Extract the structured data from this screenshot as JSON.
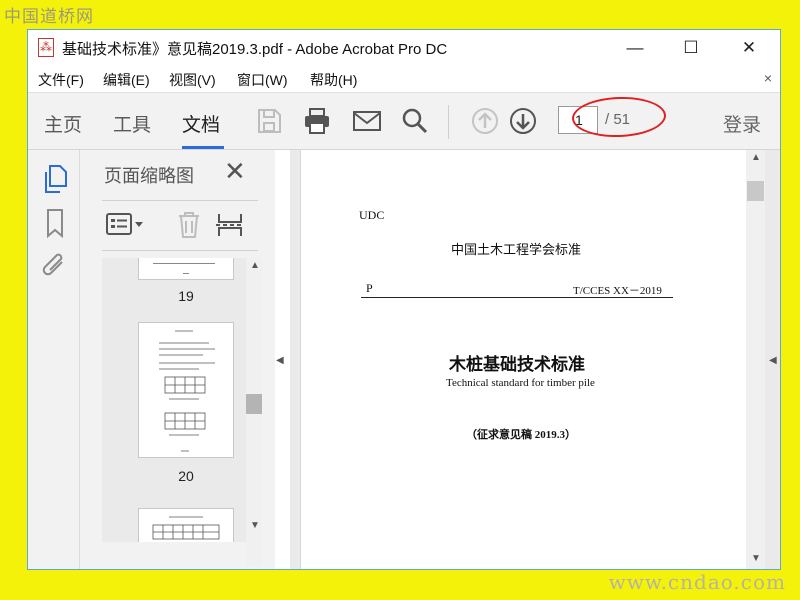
{
  "watermarks": {
    "top": "中国道桥网",
    "bottom": "www.cndao.com"
  },
  "window": {
    "title": "基础技术标准》意见稿2019.3.pdf - Adobe Acrobat Pro DC",
    "controls": {
      "minimize": "—",
      "maximize": "☐",
      "close": "✕"
    }
  },
  "menubar": {
    "items": [
      "文件(F)",
      "编辑(E)",
      "视图(V)",
      "窗口(W)",
      "帮助(H)"
    ],
    "close_doc": "×"
  },
  "toolbar": {
    "tabs": [
      "主页",
      "工具",
      "文档"
    ],
    "active_tab": "文档",
    "page_current": "1",
    "page_total": "/ 51",
    "login": "登录",
    "icons": [
      "save-icon",
      "print-icon",
      "email-icon",
      "search-icon",
      "page-up-icon",
      "page-down-icon"
    ]
  },
  "left_strip": {
    "icons": [
      "page-thumbnails-icon",
      "bookmark-icon",
      "attachment-icon"
    ]
  },
  "panel": {
    "title": "页面缩略图",
    "close": "✕",
    "thumbnails": [
      {
        "label": "19"
      },
      {
        "label": "20"
      },
      {
        "label": ""
      }
    ]
  },
  "document": {
    "udc": "UDC",
    "org_standard": "中国土木工程学会标准",
    "p": "P",
    "code": "T/CCES XX－2019",
    "title_cn": "木桩基础技术标准",
    "title_en": "Technical standard for timber pile",
    "draft": "（征求意见稿 2019.3）"
  },
  "colors": {
    "accent": "#2b6cd9",
    "highlight": "#e02020",
    "window_border": "#5aa8e0",
    "background": "#f5f20a"
  }
}
